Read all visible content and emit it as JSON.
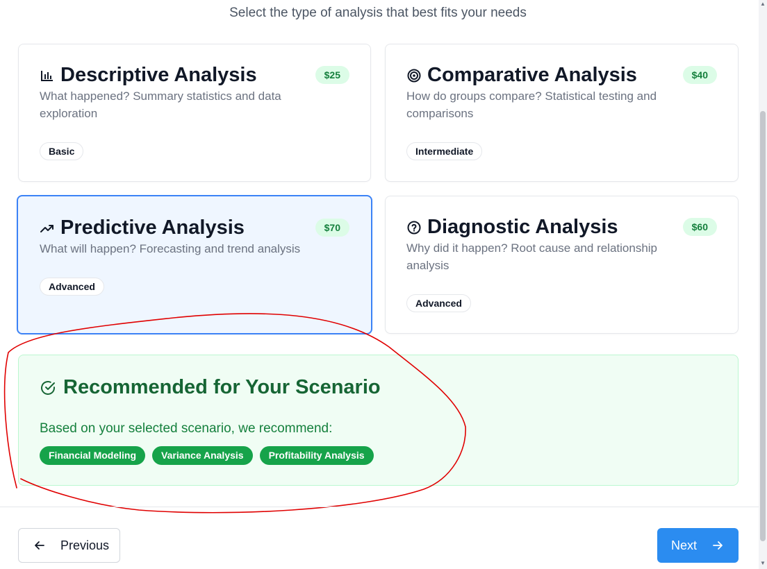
{
  "header": {
    "subtitle": "Select the type of analysis that best fits your needs"
  },
  "cards": [
    {
      "title": "Descriptive Analysis",
      "description": "What happened? Summary statistics and data exploration",
      "price": "$25",
      "level": "Basic",
      "icon": "bar-chart-icon",
      "selected": false
    },
    {
      "title": "Comparative Analysis",
      "description": "How do groups compare? Statistical testing and comparisons",
      "price": "$40",
      "level": "Intermediate",
      "icon": "target-icon",
      "selected": false
    },
    {
      "title": "Predictive Analysis",
      "description": "What will happen? Forecasting and trend analysis",
      "price": "$70",
      "level": "Advanced",
      "icon": "trending-up-icon",
      "selected": true
    },
    {
      "title": "Diagnostic Analysis",
      "description": "Why did it happen? Root cause and relationship analysis",
      "price": "$60",
      "level": "Advanced",
      "icon": "help-circle-icon",
      "selected": false
    }
  ],
  "recommendation": {
    "title": "Recommended for Your Scenario",
    "text": "Based on your selected scenario, we recommend:",
    "icon": "check-circle-icon",
    "tags": [
      "Financial Modeling",
      "Variance Analysis",
      "Profitability Analysis"
    ]
  },
  "footer": {
    "previous_label": "Previous",
    "next_label": "Next"
  },
  "colors": {
    "accent": "#2b8cf0",
    "selected_border": "#3b82f6",
    "recommend_green": "#16a34a",
    "annotation": "#e00000"
  }
}
